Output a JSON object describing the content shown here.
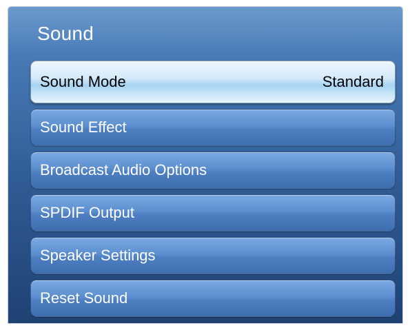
{
  "menu": {
    "title": "Sound",
    "items": [
      {
        "label": "Sound Mode",
        "value": "Standard",
        "selected": true
      },
      {
        "label": "Sound Effect"
      },
      {
        "label": "Broadcast Audio Options"
      },
      {
        "label": "SPDIF Output"
      },
      {
        "label": "Speaker Settings"
      },
      {
        "label": "Reset Sound"
      }
    ]
  }
}
